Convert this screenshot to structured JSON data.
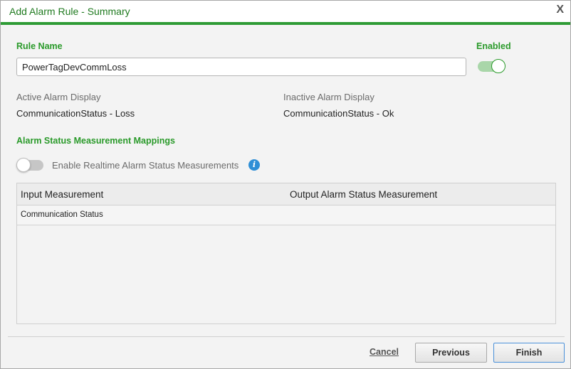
{
  "dialog": {
    "title": "Add Alarm Rule - Summary",
    "close_label": "X"
  },
  "rule": {
    "name_label": "Rule Name",
    "name_value": "PowerTagDevCommLoss",
    "enabled_label": "Enabled",
    "enabled": true
  },
  "display": {
    "active_label": "Active Alarm Display",
    "active_value": "CommunicationStatus - Loss",
    "inactive_label": "Inactive Alarm Display",
    "inactive_value": "CommunicationStatus - Ok"
  },
  "mappings": {
    "section_title": "Alarm Status Measurement Mappings",
    "realtime_label": "Enable Realtime Alarm Status Measurements",
    "realtime_enabled": false,
    "info_glyph": "i",
    "columns": [
      "Input Measurement",
      "Output Alarm Status Measurement"
    ],
    "rows": [
      [
        "Communication Status",
        ""
      ]
    ]
  },
  "footer": {
    "cancel_label": "Cancel",
    "previous_label": "Previous",
    "finish_label": "Finish"
  },
  "colors": {
    "accent_green": "#2e9b35",
    "label_green": "#2a9a2a",
    "info_blue": "#2f8fd6"
  },
  "icons": {
    "close": "close-icon",
    "info": "info-icon"
  }
}
